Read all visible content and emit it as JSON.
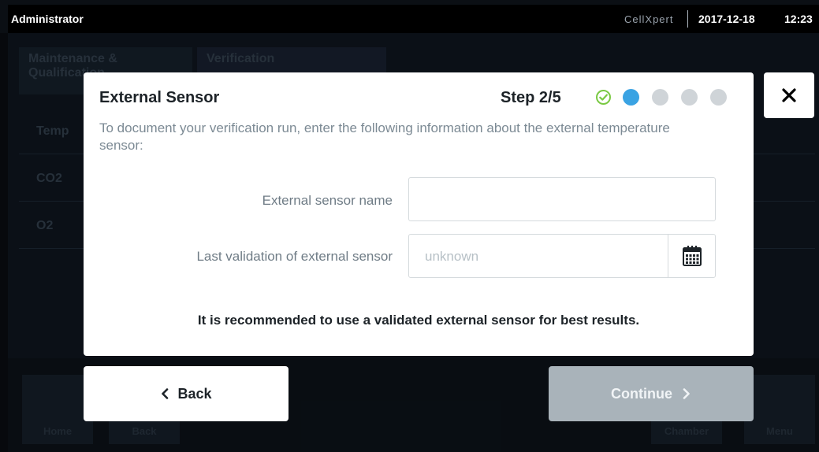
{
  "topbar": {
    "user": "Administrator",
    "brand": "CellXpert",
    "date": "2017-12-18",
    "time": "12:23"
  },
  "background": {
    "tabs": [
      "Maintenance & Qualification",
      "Verification"
    ],
    "rows": [
      "Temp",
      "CO2",
      "O2"
    ],
    "buttons": [
      "Home",
      "Back",
      "Chamber",
      "Menu"
    ]
  },
  "dialog": {
    "title": "External Sensor",
    "step": "Step 2/5",
    "steps": [
      {
        "state": "done",
        "icon": "check-circle-icon"
      },
      {
        "state": "current"
      },
      {
        "state": "pending"
      },
      {
        "state": "pending"
      },
      {
        "state": "pending"
      }
    ],
    "intro": "To document your verification run, enter the following information about the external temperature sensor:",
    "fields": {
      "name_label": "External sensor name",
      "name_value": "",
      "validation_label": "Last validation of external sensor",
      "validation_placeholder": "unknown"
    },
    "note": "It is recommended to use a validated external sensor for best results."
  },
  "buttons": {
    "back": "Back",
    "continue": "Continue"
  },
  "colors": {
    "accent": "#3aa3e3",
    "done": "#7ac943",
    "disabled_button": "#a9b3ba"
  }
}
